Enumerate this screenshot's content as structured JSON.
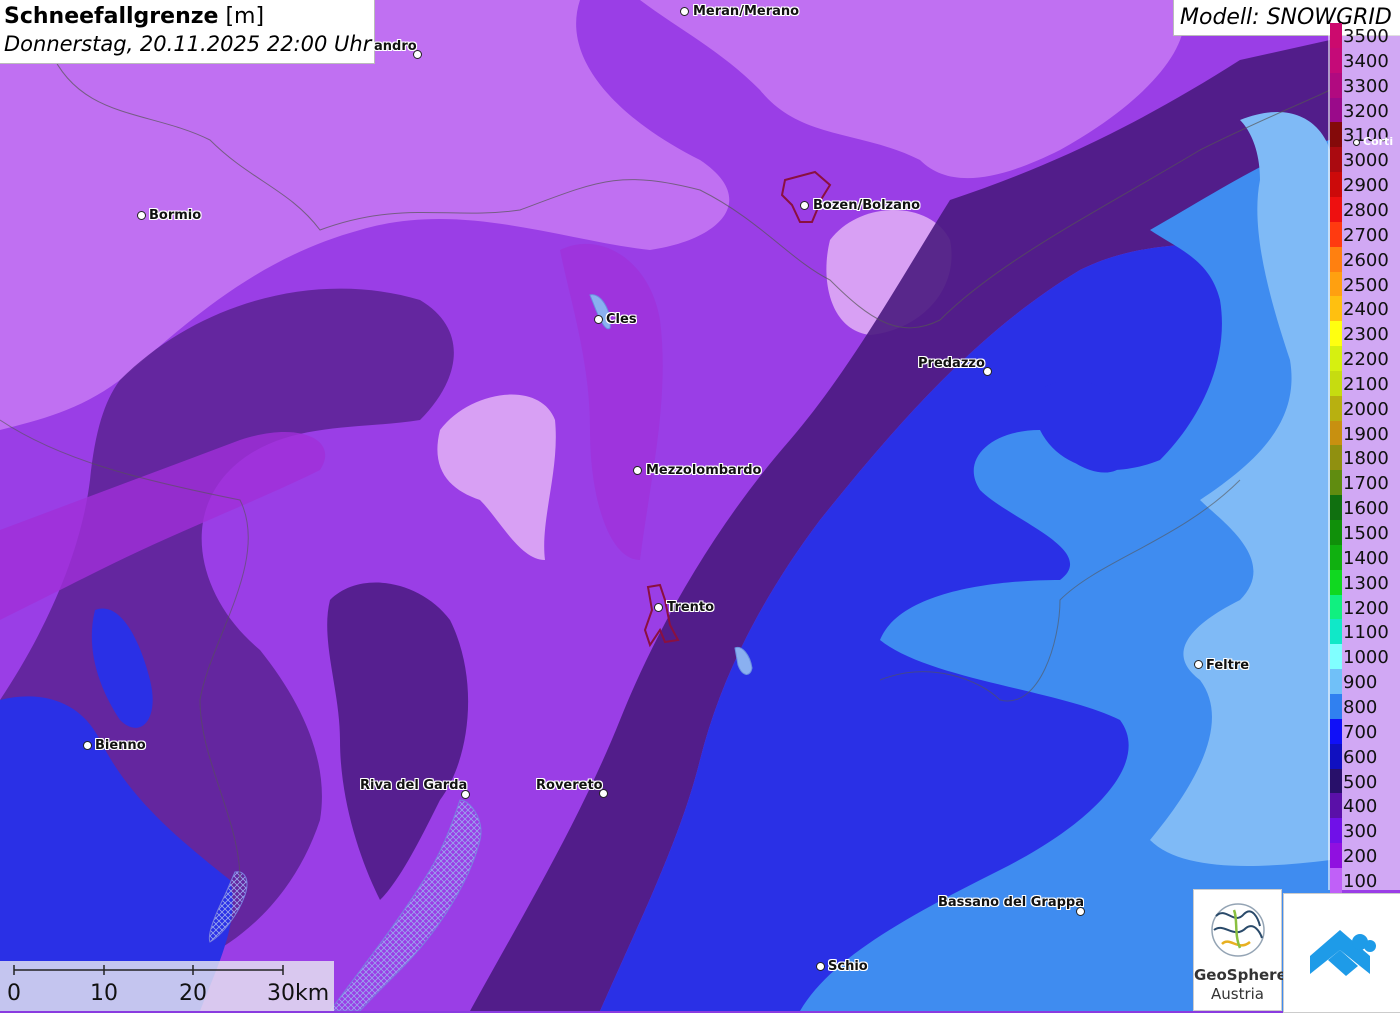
{
  "title": {
    "main_bold": "Schneefallgrenze",
    "main_unit": " [m]",
    "subtitle": "Donnerstag, 20.11.2025 22:00 Uhr"
  },
  "model_label": "Modell: SNOWGRID",
  "legend": [
    {
      "label": "3500",
      "color": "#cc0a6e"
    },
    {
      "label": "3400",
      "color": "#c50a78"
    },
    {
      "label": "3300",
      "color": "#b10a80"
    },
    {
      "label": "3200",
      "color": "#9a0a8a"
    },
    {
      "label": "3100",
      "color": "#840a0a"
    },
    {
      "label": "3000",
      "color": "#aa0a10"
    },
    {
      "label": "2900",
      "color": "#cc0a0a"
    },
    {
      "label": "2800",
      "color": "#ee1010"
    },
    {
      "label": "2700",
      "color": "#ff3a10"
    },
    {
      "label": "2600",
      "color": "#ff8010"
    },
    {
      "label": "2500",
      "color": "#ffa010"
    },
    {
      "label": "2400",
      "color": "#ffc010"
    },
    {
      "label": "2300",
      "color": "#ffff10"
    },
    {
      "label": "2200",
      "color": "#d6f010"
    },
    {
      "label": "2100",
      "color": "#c6dc10"
    },
    {
      "label": "2000",
      "color": "#b8b010"
    },
    {
      "label": "1900",
      "color": "#c89010"
    },
    {
      "label": "1800",
      "color": "#909010"
    },
    {
      "label": "1700",
      "color": "#608c10"
    },
    {
      "label": "1600",
      "color": "#107010"
    },
    {
      "label": "1500",
      "color": "#10900a"
    },
    {
      "label": "1400",
      "color": "#10b010"
    },
    {
      "label": "1300",
      "color": "#10d820"
    },
    {
      "label": "1200",
      "color": "#10f080"
    },
    {
      "label": "1100",
      "color": "#10e8c8"
    },
    {
      "label": "1000",
      "color": "#80ffff"
    },
    {
      "label": "900",
      "color": "#70c0f8"
    },
    {
      "label": "800",
      "color": "#3080f0"
    },
    {
      "label": "700",
      "color": "#1010f8"
    },
    {
      "label": "600",
      "color": "#1010c0"
    },
    {
      "label": "500",
      "color": "#28106a"
    },
    {
      "label": "400",
      "color": "#5a10a8"
    },
    {
      "label": "300",
      "color": "#7010e8"
    },
    {
      "label": "200",
      "color": "#9010e0"
    },
    {
      "label": "100",
      "color": "#c060f8"
    }
  ],
  "cities": [
    {
      "name": "Meran/Merano"
    },
    {
      "name": "andro"
    },
    {
      "name": "Bormio"
    },
    {
      "name": "Bozen/Bolzano"
    },
    {
      "name": "Cles"
    },
    {
      "name": "Predazzo"
    },
    {
      "name": "Mezzolombardo"
    },
    {
      "name": "Trento"
    },
    {
      "name": "Feltre"
    },
    {
      "name": "Bienno"
    },
    {
      "name": "Riva del Garda"
    },
    {
      "name": "Rovereto"
    },
    {
      "name": "Bassano del Grappa"
    },
    {
      "name": "Schio"
    },
    {
      "name": "Corti"
    }
  ],
  "scale_bar": [
    "0",
    "10",
    "20",
    "30km"
  ],
  "logo": {
    "line1": "GeoSphere",
    "line2": "Austria"
  }
}
